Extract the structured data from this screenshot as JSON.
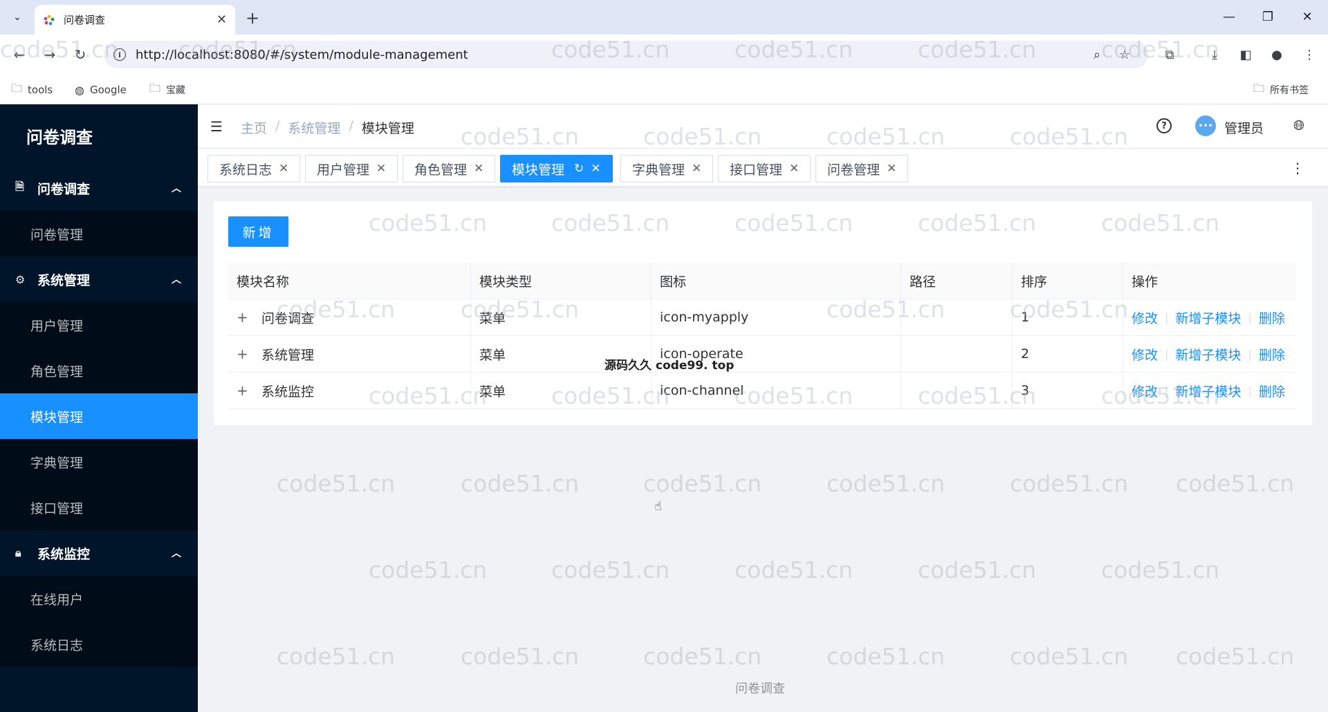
{
  "browser": {
    "tab_title": "问卷调查",
    "url": "http://localhost:8080/#/system/module-management",
    "bookmarks": [
      "tools",
      "Google",
      "宝藏"
    ],
    "all_bookmarks": "所有书签"
  },
  "sidebar": {
    "logo": "问卷调查",
    "groups": [
      {
        "label": "问卷调查",
        "icon": "document-icon",
        "items": [
          "问卷管理"
        ]
      },
      {
        "label": "系统管理",
        "icon": "gear-icon",
        "items": [
          "用户管理",
          "角色管理",
          "模块管理",
          "字典管理",
          "接口管理"
        ]
      },
      {
        "label": "系统监控",
        "icon": "lock-icon",
        "items": [
          "在线用户",
          "系统日志"
        ]
      }
    ],
    "active_item": "模块管理"
  },
  "header": {
    "breadcrumb": [
      "主页",
      "系统管理",
      "模块管理"
    ],
    "username": "管理员"
  },
  "tags": [
    {
      "label": "系统日志"
    },
    {
      "label": "用户管理"
    },
    {
      "label": "角色管理"
    },
    {
      "label": "模块管理",
      "active": true
    },
    {
      "label": "字典管理"
    },
    {
      "label": "接口管理"
    },
    {
      "label": "问卷管理"
    }
  ],
  "main": {
    "add_button": "新增",
    "columns": [
      "模块名称",
      "模块类型",
      "图标",
      "路径",
      "排序",
      "操作"
    ],
    "rows": [
      {
        "name": "问卷调查",
        "type": "菜单",
        "icon": "icon-myapply",
        "path": "",
        "order": "1"
      },
      {
        "name": "系统管理",
        "type": "菜单",
        "icon": "icon-operate",
        "path": "",
        "order": "2"
      },
      {
        "name": "系统监控",
        "type": "菜单",
        "icon": "icon-channel",
        "path": "",
        "order": "3"
      }
    ],
    "actions": {
      "edit": "修改",
      "add_child": "新增子模块",
      "delete": "删除"
    }
  },
  "overlay_text": "源码久久 code99. top",
  "watermark": "code51.cn",
  "footer": "问卷调查",
  "colors": {
    "primary": "#1890ff",
    "sidebar": "#001529",
    "submenu": "#000c17"
  }
}
